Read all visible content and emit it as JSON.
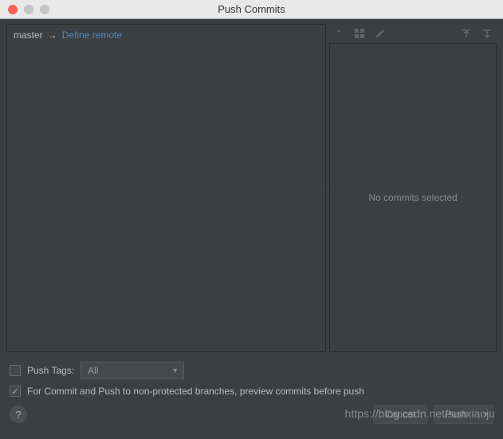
{
  "window": {
    "title": "Push Commits"
  },
  "branch": {
    "local": "master",
    "arrow": "→",
    "remote_link": "Define remote"
  },
  "right": {
    "empty_message": "No commits selected"
  },
  "footer": {
    "push_tags_label": "Push Tags:",
    "push_tags_selected": "All",
    "preview_label": "For Commit and Push to non-protected branches, preview commits before push",
    "help": "?",
    "cancel": "Cancel",
    "push": "Push"
  },
  "watermark": "https://blog.csdn.net/sunxiaoju"
}
